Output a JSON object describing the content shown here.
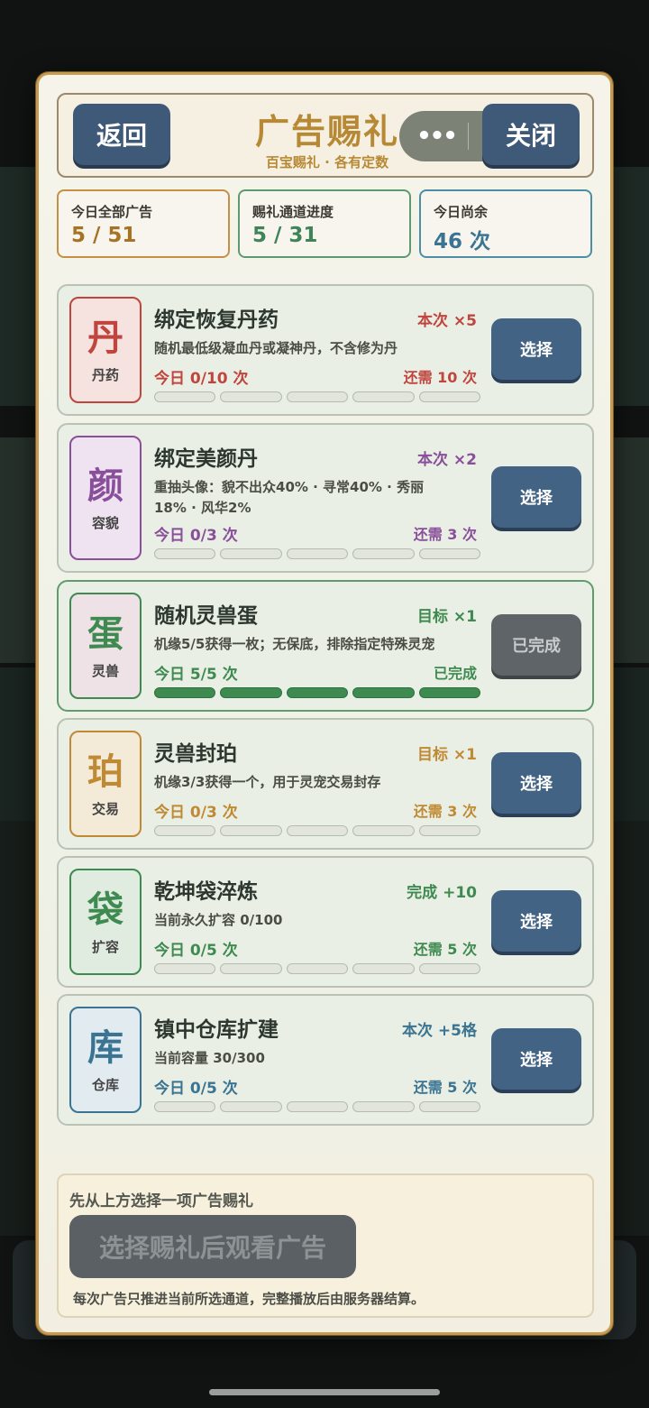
{
  "header": {
    "back_label": "返回",
    "title": "广告赐礼",
    "subtitle": "百宝赐礼 · 各有定数",
    "close_label": "关闭",
    "capsule_more": "•••"
  },
  "stats": [
    {
      "label": "今日全部广告",
      "value": "5 / 51"
    },
    {
      "label": "赐礼通道进度",
      "value": "5 / 31"
    },
    {
      "label": "今日尚余",
      "value": "46 次"
    }
  ],
  "cards": [
    {
      "glyph": "丹",
      "category": "丹药",
      "title": "绑定恢复丹药",
      "tag": "本次 ×5",
      "desc": "随机最低级凝血丹或凝神丹，不含修为丹",
      "today": "今日 0/10 次",
      "need": "还需 10 次",
      "progress": 0,
      "button": "选择",
      "color": "#c0453e"
    },
    {
      "glyph": "颜",
      "category": "容貌",
      "title": "绑定美颜丹",
      "tag": "本次 ×2",
      "desc": "重抽头像：貌不出众40% · 寻常40% · 秀丽18% · 风华2%",
      "today": "今日 0/3 次",
      "need": "还需 3 次",
      "progress": 0,
      "button": "选择",
      "color": "#8a4f9b"
    },
    {
      "glyph": "蛋",
      "category": "灵兽",
      "title": "随机灵兽蛋",
      "tag": "目标 ×1",
      "desc": "机缘5/5获得一枚；无保底，排除指定特殊灵宠",
      "today": "今日 5/5 次",
      "need": "已完成",
      "progress": 1,
      "button": "已完成",
      "color": "#3e8a50"
    },
    {
      "glyph": "珀",
      "category": "交易",
      "title": "灵兽封珀",
      "tag": "目标 ×1",
      "desc": "机缘3/3获得一个，用于灵宠交易封存",
      "today": "今日 0/3 次",
      "need": "还需 3 次",
      "progress": 0,
      "button": "选择",
      "color": "#c08a34"
    },
    {
      "glyph": "袋",
      "category": "扩容",
      "title": "乾坤袋淬炼",
      "tag": "完成 +10",
      "desc": "当前永久扩容 0/100",
      "today": "今日 0/5 次",
      "need": "还需 5 次",
      "progress": 0,
      "button": "选择",
      "color": "#3e8a50"
    },
    {
      "glyph": "库",
      "category": "仓库",
      "title": "镇中仓库扩建",
      "tag": "本次 +5格",
      "desc": "当前容量 30/300",
      "today": "今日 0/5 次",
      "need": "还需 5 次",
      "progress": 0,
      "button": "选择",
      "color": "#3b7492"
    }
  ],
  "footer": {
    "hint": "先从上方选择一项广告赐礼",
    "watch_label": "选择赐礼后观看广告",
    "note": "每次广告只推进当前所选通道，完整播放后由服务器结算。"
  }
}
